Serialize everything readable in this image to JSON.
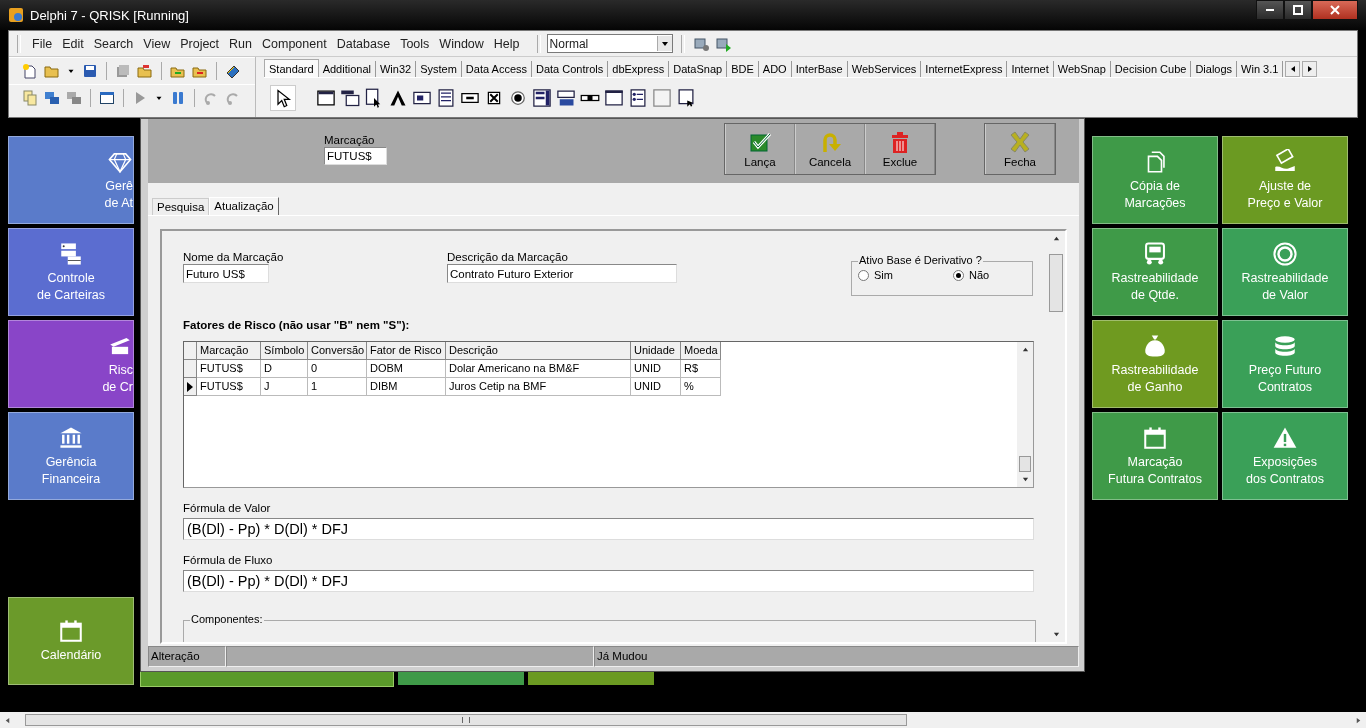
{
  "ide": {
    "title": "Delphi 7 - QRISK [Running]",
    "menu": [
      "File",
      "Edit",
      "Search",
      "View",
      "Project",
      "Run",
      "Component",
      "Database",
      "Tools",
      "Window",
      "Help"
    ],
    "desktop_combo": "Normal",
    "palette_tabs": [
      {
        "label": "Standard",
        "selected": true
      },
      {
        "label": "Additional",
        "selected": false
      },
      {
        "label": "Win32",
        "selected": false
      },
      {
        "label": "System",
        "selected": false
      },
      {
        "label": "Data Access",
        "selected": false
      },
      {
        "label": "Data Controls",
        "selected": false
      },
      {
        "label": "dbExpress",
        "selected": false
      },
      {
        "label": "DataSnap",
        "selected": false
      },
      {
        "label": "BDE",
        "selected": false
      },
      {
        "label": "ADO",
        "selected": false
      },
      {
        "label": "InterBase",
        "selected": false
      },
      {
        "label": "WebServices",
        "selected": false
      },
      {
        "label": "InternetExpress",
        "selected": false
      },
      {
        "label": "Internet",
        "selected": false
      },
      {
        "label": "WebSnap",
        "selected": false
      },
      {
        "label": "Decision Cube",
        "selected": false
      },
      {
        "label": "Dialogs",
        "selected": false
      },
      {
        "label": "Win 3.1",
        "selected": false
      }
    ]
  },
  "app": {
    "left_tiles": [
      {
        "label": "Gerê\nde At",
        "color": "#5a7bca"
      },
      {
        "label": "Controle\nde Carteiras",
        "color": "#5b6dd0"
      },
      {
        "label": "Risc\nde  Cr",
        "color": "#8945c8"
      },
      {
        "label": "Gerência\nFinanceira",
        "color": "#5a7bca"
      }
    ],
    "calendar_tile": {
      "label": "Calendário",
      "color": "#6b9a2a"
    },
    "right_tiles": [
      {
        "label": "Cópia de\nMarcações",
        "color": "#3f9a48"
      },
      {
        "label": "Ajuste de\nPreço e Valor",
        "color": "#6b9a22"
      },
      {
        "label": "Rastreabilidade\nde Qtde.",
        "color": "#3f9a48"
      },
      {
        "label": "Rastreabilidade\nde Valor",
        "color": "#3aa058"
      },
      {
        "label": "Rastreabilidade\nde Ganho",
        "color": "#6f9a20"
      },
      {
        "label": "Preço Futuro\nContratos",
        "color": "#3aa058"
      },
      {
        "label": "Marcação\nFutura Contratos",
        "color": "#3f9a48"
      },
      {
        "label": "Exposições\ndos Contratos",
        "color": "#3aa058"
      }
    ]
  },
  "form": {
    "marcacao": {
      "label": "Marcação",
      "value": "FUTUS$"
    },
    "actions": [
      {
        "label": "Lança",
        "kind": "post"
      },
      {
        "label": "Cancela",
        "kind": "cancel"
      },
      {
        "label": "Exclue",
        "kind": "delete"
      },
      {
        "label": "Fecha",
        "kind": "close"
      }
    ],
    "tabs": [
      {
        "label": "Pesquisa",
        "selected": false
      },
      {
        "label": "Atualização",
        "selected": true
      }
    ],
    "nome": {
      "label": "Nome da Marcação",
      "value": "Futuro US$"
    },
    "descricao": {
      "label": "Descrição da Marcação",
      "value": "Contrato Futuro Exterior"
    },
    "derivativo": {
      "legend": "Ativo Base é Derivativo ?",
      "options": [
        {
          "label": "Sim",
          "selected": false
        },
        {
          "label": "Não",
          "selected": true
        }
      ]
    },
    "grid": {
      "title": "Fatores de Risco (não usar \"B\" nem \"S\"):",
      "columns": [
        "Marcação",
        "Símbolo",
        "Conversão",
        "Fator de Risco",
        "Descrição",
        "Unidade",
        "Moeda"
      ],
      "rows": [
        {
          "cells": [
            "FUTUS$",
            "D",
            "0",
            "DOBM",
            "Dolar Americano na BM&F",
            "UNID",
            "R$"
          ],
          "selected": false
        },
        {
          "cells": [
            "FUTUS$",
            "J",
            "1",
            "DIBM",
            "Juros Cetip na BMF",
            "UNID",
            "%"
          ],
          "selected": true
        }
      ]
    },
    "formula_valor": {
      "label": "Fórmula de Valor",
      "value": "(B(Dl) - Pp) * D(Dl) * DFJ"
    },
    "formula_fluxo": {
      "label": "Fórmula de Fluxo",
      "value": "(B(Dl) - Pp) * D(Dl) * DFJ"
    },
    "componentes": "Componentes:",
    "status": [
      "Alteração",
      "Já Mudou"
    ]
  }
}
